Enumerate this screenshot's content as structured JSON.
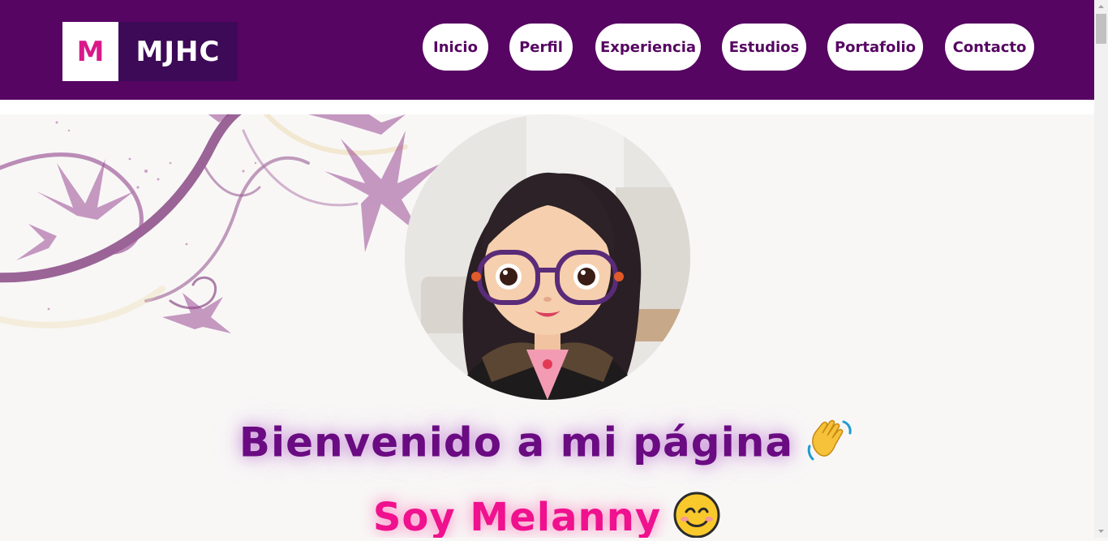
{
  "header": {
    "logo_mark": "M",
    "logo_text": "MJHC",
    "nav": [
      "Inicio",
      "Perfil",
      "Experiencia",
      "Estudios",
      "Portafolio",
      "Contacto"
    ]
  },
  "hero": {
    "welcome": "Bienvenido a mi página",
    "intro": "Soy Melanny"
  },
  "colors": {
    "brand_purple": "#560562",
    "welcome_text": "#6a0b82",
    "intro_pink": "#f0118e",
    "logo_pink": "#d9188a"
  },
  "icons": {
    "welcome_emoji": "waving-hand-icon",
    "intro_emoji": "smiling-face-icon"
  }
}
